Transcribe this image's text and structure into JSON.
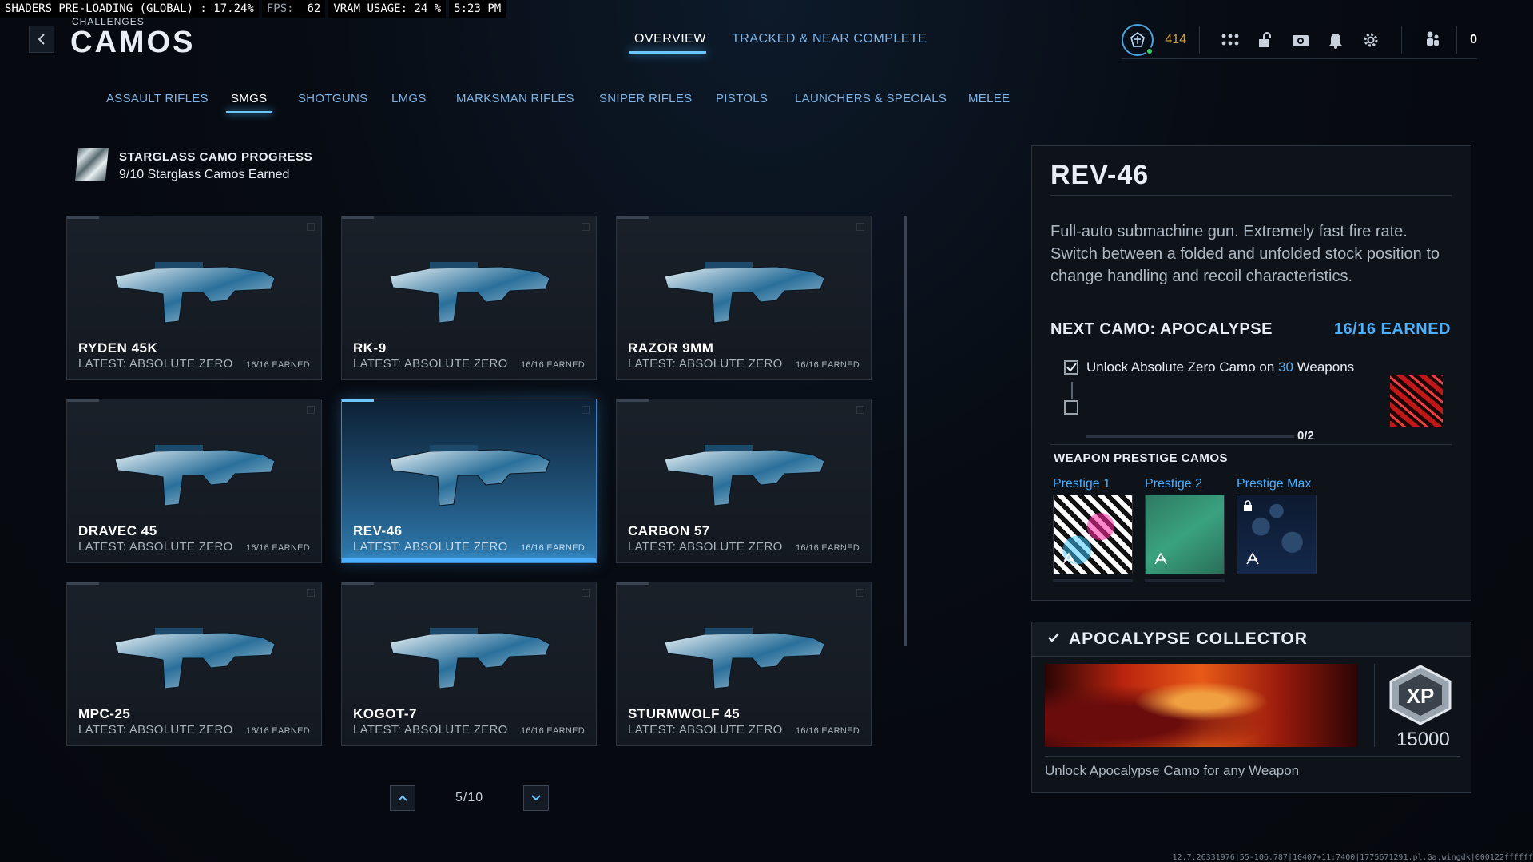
{
  "debug": {
    "shaders": "SHADERS PRE-LOADING (GLOBAL) : 17.24%",
    "fps_label": "FPS:",
    "fps_value": "62",
    "vram": "VRAM USAGE: 24 %",
    "time": "5:23 PM"
  },
  "header": {
    "section": "CHALLENGES",
    "title": "CAMOS",
    "tabs": [
      {
        "label": "OVERVIEW",
        "active": true
      },
      {
        "label": "TRACKED & NEAR COMPLETE",
        "active": false
      }
    ],
    "rank_value": "414",
    "currency_value": "0"
  },
  "categories": [
    {
      "label": "ASSAULT RIFLES"
    },
    {
      "label": "SMGS",
      "active": true
    },
    {
      "label": "SHOTGUNS"
    },
    {
      "label": "LMGS"
    },
    {
      "label": "MARKSMAN RIFLES"
    },
    {
      "label": "SNIPER RIFLES"
    },
    {
      "label": "PISTOLS"
    },
    {
      "label": "LAUNCHERS & SPECIALS"
    },
    {
      "label": "MELEE"
    }
  ],
  "starglass": {
    "title": "STARGLASS CAMO PROGRESS",
    "subtitle": "9/10 Starglass Camos Earned"
  },
  "weapons": [
    {
      "name": "RYDEN 45K",
      "latest": "LATEST: ABSOLUTE ZERO",
      "earned": "16/16 EARNED"
    },
    {
      "name": "RK-9",
      "latest": "LATEST: ABSOLUTE ZERO",
      "earned": "16/16 EARNED"
    },
    {
      "name": "RAZOR 9MM",
      "latest": "LATEST: ABSOLUTE ZERO",
      "earned": "16/16 EARNED"
    },
    {
      "name": "DRAVEC 45",
      "latest": "LATEST: ABSOLUTE ZERO",
      "earned": "16/16 EARNED"
    },
    {
      "name": "REV-46",
      "latest": "LATEST: ABSOLUTE ZERO",
      "earned": "16/16 EARNED",
      "selected": true
    },
    {
      "name": "CARBON 57",
      "latest": "LATEST: ABSOLUTE ZERO",
      "earned": "16/16 EARNED"
    },
    {
      "name": "MPC-25",
      "latest": "LATEST: ABSOLUTE ZERO",
      "earned": "16/16 EARNED"
    },
    {
      "name": "KOGOT-7",
      "latest": "LATEST: ABSOLUTE ZERO",
      "earned": "16/16 EARNED"
    },
    {
      "name": "STURMWOLF 45",
      "latest": "LATEST: ABSOLUTE ZERO",
      "earned": "16/16 EARNED"
    }
  ],
  "pagination": {
    "text": "5/10"
  },
  "detail": {
    "title": "REV-46",
    "description": "Full-auto submachine gun. Extremely fast fire rate. Switch between a folded and unfolded stock position to change handling and recoil characteristics.",
    "next_camo": "NEXT CAMO: APOCALYPSE",
    "next_earned": "16/16 EARNED",
    "requirement_pre": "Unlock Absolute Zero Camo on ",
    "requirement_count": "30",
    "requirement_post": " Weapons",
    "progress": "0/2",
    "prestige_title": "WEAPON PRESTIGE CAMOS",
    "prestige": [
      {
        "label": "Prestige 1"
      },
      {
        "label": "Prestige 2"
      },
      {
        "label": "Prestige Max",
        "locked": true
      }
    ]
  },
  "collector": {
    "title": "APOCALYPSE COLLECTOR",
    "xp_badge": "XP",
    "xp_amount": "15000",
    "description": "Unlock Apocalypse Camo for any Weapon"
  },
  "footer": {
    "code": "12.7.26331976|55-106.787|10407+11:7400|1775671291.pl.Ga.wingdk|000122ffffff"
  },
  "colors": {
    "accent": "#4ab0ff",
    "rank_gold": "#c9a24a",
    "background": "#070b12"
  }
}
